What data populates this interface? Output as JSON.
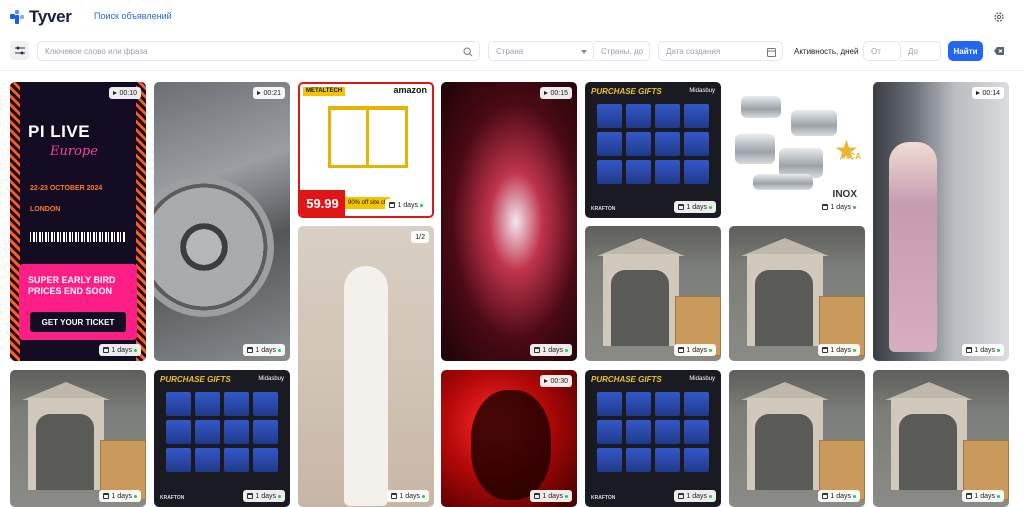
{
  "app": {
    "name": "Tyver",
    "nav_link": "Поиск объявлений"
  },
  "filters": {
    "keyword_placeholder": "Ключевое слово или фраза",
    "country_placeholder": "Страна",
    "country_to_placeholder": "Страны, до",
    "created_placeholder": "Дата создания",
    "activity_label": "Активность, дней",
    "from_placeholder": "От",
    "to_placeholder": "До",
    "find_label": "Найти"
  },
  "colors": {
    "accent": "#2466f0",
    "active_dot": "#23c94b"
  },
  "cards": [
    {
      "id": "pi-live",
      "days": "1 days",
      "duration": "00:10",
      "text": {
        "title": "PI LIVE",
        "subtitle": "Europe",
        "date": "22-23 OCTOBER 2024",
        "location": "LONDON",
        "promo": "SUPER EARLY BIRD PRICES END SOON",
        "cta": "GET YOUR TICKET"
      }
    },
    {
      "id": "factory",
      "days": "1 days",
      "duration": "00:21"
    },
    {
      "id": "scaffold",
      "days": "1 days",
      "text": {
        "brand": "METALTECH",
        "store": "amazon",
        "price": "59.99",
        "offer": "90% off site ch"
      }
    },
    {
      "id": "blur-red",
      "days": "1 days",
      "duration": "00:15"
    },
    {
      "id": "gifts-1",
      "days": "1 days",
      "text": {
        "title": "PURCHASE GIFTS",
        "brand": "Midasbuy",
        "footer": "KRAFTON"
      }
    },
    {
      "id": "pots",
      "days": "1 days",
      "text": {
        "badge": "NCA",
        "brand": "INOX"
      }
    },
    {
      "id": "dress-pink",
      "days": "1 days",
      "duration": "00:14"
    },
    {
      "id": "dress-white",
      "days": "1 days",
      "counter": "1/2"
    },
    {
      "id": "shed-1",
      "days": "1 days"
    },
    {
      "id": "shed-2",
      "days": "1 days"
    },
    {
      "id": "shed-3",
      "days": "1 days"
    },
    {
      "id": "gifts-2",
      "days": "1 days",
      "text": {
        "title": "PURCHASE GIFTS",
        "brand": "Midasbuy",
        "footer": "KRAFTON"
      }
    },
    {
      "id": "red-shadow",
      "days": "1 days",
      "duration": "00:30"
    },
    {
      "id": "gifts-3",
      "days": "1 days",
      "text": {
        "title": "PURCHASE GIFTS",
        "brand": "Midasbuy",
        "footer": "KRAFTON"
      }
    },
    {
      "id": "shed-4",
      "days": "1 days"
    },
    {
      "id": "shed-5",
      "days": "1 days"
    }
  ]
}
